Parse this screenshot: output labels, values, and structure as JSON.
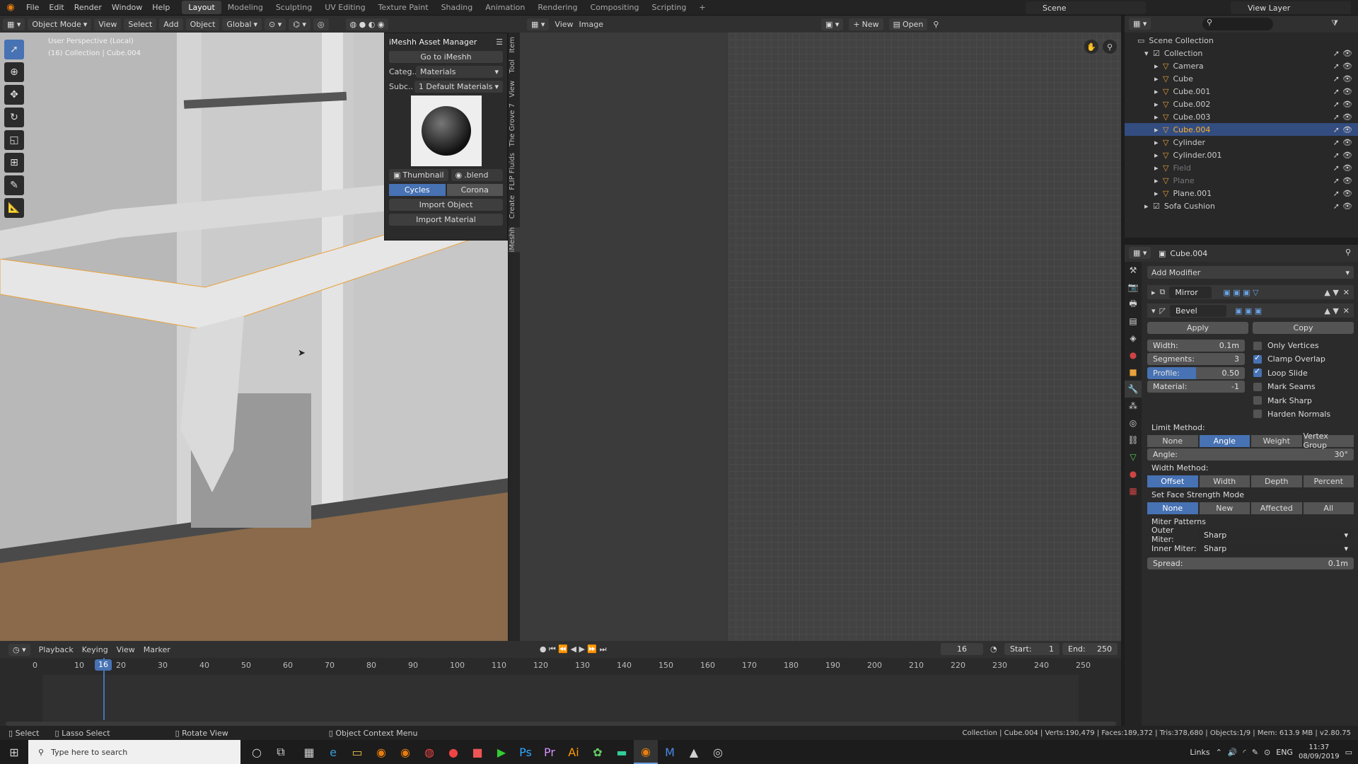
{
  "menu": [
    "File",
    "Edit",
    "Render",
    "Window",
    "Help"
  ],
  "workspaces": [
    "Layout",
    "Modeling",
    "Sculpting",
    "UV Editing",
    "Texture Paint",
    "Shading",
    "Animation",
    "Rendering",
    "Compositing",
    "Scripting"
  ],
  "workspace_active": "Layout",
  "scene": "Scene",
  "view_layer": "View Layer",
  "viewport": {
    "mode": "Object Mode",
    "menu": [
      "View",
      "Select",
      "Add",
      "Object"
    ],
    "orientation": "Global",
    "overlay_text_1": "User Perspective (Local)",
    "overlay_text_2": "(16) Collection | Cube.004"
  },
  "asset_panel": {
    "title": "iMeshh Asset Manager",
    "go_button": "Go to iMeshh",
    "category_label": "Categ..",
    "category_value": "Materials",
    "subcategory_label": "Subc..",
    "subcategory_value": "1 Default Materials",
    "thumbnail_btn": "Thumbnail",
    "blend_btn": ".blend",
    "engine_cycles": "Cycles",
    "engine_corona": "Corona",
    "import_object": "Import Object",
    "import_material": "Import Material"
  },
  "side_tabs": [
    "Item",
    "Tool",
    "View",
    "The Grove 7",
    "FLIP Fluids",
    "Create",
    "iMeshh"
  ],
  "image_editor": {
    "menu": [
      "View",
      "Image"
    ],
    "new": "New",
    "open": "Open"
  },
  "outliner": {
    "root": "Scene Collection",
    "items": [
      {
        "name": "Collection",
        "level": 1,
        "active": false,
        "dim": false
      },
      {
        "name": "Camera",
        "level": 2,
        "active": false,
        "dim": false
      },
      {
        "name": "Cube",
        "level": 2,
        "active": false,
        "dim": false
      },
      {
        "name": "Cube.001",
        "level": 2,
        "active": false,
        "dim": false
      },
      {
        "name": "Cube.002",
        "level": 2,
        "active": false,
        "dim": false
      },
      {
        "name": "Cube.003",
        "level": 2,
        "active": false,
        "dim": false
      },
      {
        "name": "Cube.004",
        "level": 2,
        "active": true,
        "dim": false
      },
      {
        "name": "Cylinder",
        "level": 2,
        "active": false,
        "dim": false
      },
      {
        "name": "Cylinder.001",
        "level": 2,
        "active": false,
        "dim": false
      },
      {
        "name": "Field",
        "level": 2,
        "active": false,
        "dim": true
      },
      {
        "name": "Plane",
        "level": 2,
        "active": false,
        "dim": true
      },
      {
        "name": "Plane.001",
        "level": 2,
        "active": false,
        "dim": false
      },
      {
        "name": "Sofa Cushion",
        "level": 1,
        "active": false,
        "dim": false
      }
    ]
  },
  "properties": {
    "object": "Cube.004",
    "add_modifier": "Add Modifier",
    "mirror": "Mirror",
    "bevel": "Bevel",
    "apply": "Apply",
    "copy": "Copy",
    "width_label": "Width:",
    "width_value": "0.1m",
    "segments_label": "Segments:",
    "segments_value": "3",
    "profile_label": "Profile:",
    "profile_value": "0.50",
    "material_label": "Material:",
    "material_value": "-1",
    "only_vertices": "Only Vertices",
    "clamp_overlap": "Clamp Overlap",
    "loop_slide": "Loop Slide",
    "mark_seams": "Mark Seams",
    "mark_sharp": "Mark Sharp",
    "harden_normals": "Harden Normals",
    "limit_method_label": "Limit Method:",
    "limit_methods": [
      "None",
      "Angle",
      "Weight",
      "Vertex Group"
    ],
    "angle_label": "Angle:",
    "angle_value": "30°",
    "width_method_label": "Width Method:",
    "width_methods": [
      "Offset",
      "Width",
      "Depth",
      "Percent"
    ],
    "face_strength_label": "Set Face Strength Mode",
    "face_strength": [
      "None",
      "New",
      "Affected",
      "All"
    ],
    "miter_label": "Miter Patterns",
    "outer_miter_label": "Outer Miter:",
    "outer_miter_value": "Sharp",
    "inner_miter_label": "Inner Miter:",
    "inner_miter_value": "Sharp",
    "spread_label": "Spread:",
    "spread_value": "0.1m"
  },
  "timeline": {
    "menu": [
      "Playback",
      "Keying",
      "View",
      "Marker"
    ],
    "current_frame": "16",
    "start_label": "Start:",
    "start": "1",
    "end_label": "End:",
    "end": "250",
    "ticks": [
      "0",
      "10",
      "20",
      "30",
      "40",
      "50",
      "60",
      "70",
      "80",
      "90",
      "100",
      "110",
      "120",
      "130",
      "140",
      "150",
      "160",
      "170",
      "180",
      "190",
      "200",
      "210",
      "220",
      "230",
      "240",
      "250"
    ]
  },
  "status": {
    "select": "Select",
    "lasso": "Lasso Select",
    "rotate": "Rotate View",
    "context": "Object Context Menu",
    "info": "Collection | Cube.004 | Verts:190,479 | Faces:189,372 | Tris:378,680 | Objects:1/9 | Mem: 613.9 MB | v2.80.75"
  },
  "taskbar": {
    "search_placeholder": "Type here to search",
    "links": "Links",
    "lang": "ENG",
    "time": "11:37",
    "date": "08/09/2019"
  }
}
